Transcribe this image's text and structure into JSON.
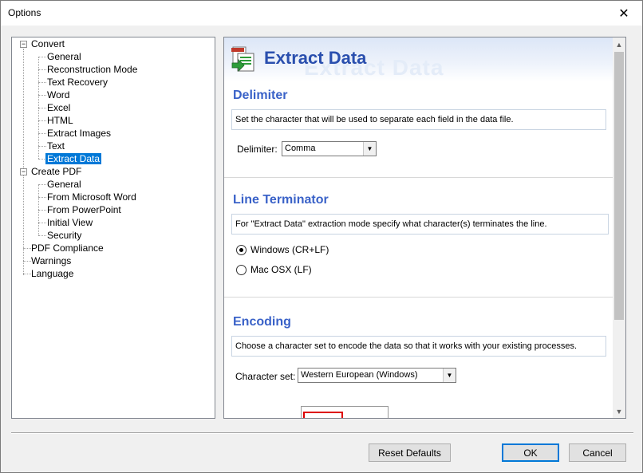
{
  "window": {
    "title": "Options",
    "close_glyph": "✕"
  },
  "tree": {
    "items": [
      {
        "label": "Convert",
        "expander": "−"
      },
      {
        "label": "General"
      },
      {
        "label": "Reconstruction Mode"
      },
      {
        "label": "Text Recovery"
      },
      {
        "label": "Word"
      },
      {
        "label": "Excel"
      },
      {
        "label": "HTML"
      },
      {
        "label": "Extract Images"
      },
      {
        "label": "Text"
      },
      {
        "label": "Extract Data",
        "selected": true
      },
      {
        "label": "Create PDF",
        "expander": "−"
      },
      {
        "label": "General"
      },
      {
        "label": "From Microsoft Word"
      },
      {
        "label": "From PowerPoint"
      },
      {
        "label": "Initial View"
      },
      {
        "label": "Security"
      },
      {
        "label": "PDF Compliance"
      },
      {
        "label": "Warnings"
      },
      {
        "label": "Language"
      }
    ]
  },
  "panel": {
    "header_title": "Extract Data",
    "header_icon": "extract-data-icon",
    "delimiter": {
      "title": "Delimiter",
      "description": "Set the character that will be used to separate each field in the data file.",
      "field_label": "Delimiter:",
      "value": "Comma"
    },
    "line_terminator": {
      "title": "Line Terminator",
      "description": "For \"Extract Data\" extraction mode specify what character(s) terminates the line.",
      "options": [
        {
          "label": "Windows (CR+LF)",
          "checked": true
        },
        {
          "label": "Mac OSX (LF)",
          "checked": false
        }
      ]
    },
    "encoding": {
      "title": "Encoding",
      "description": "Choose a character set to encode the data so that it works with your existing processes.",
      "field_label": "Character set:",
      "value": "Western European (Windows)"
    }
  },
  "buttons": {
    "reset": "Reset Defaults",
    "ok": "OK",
    "cancel": "Cancel"
  },
  "colors": {
    "accent": "#0078d7",
    "section_title": "#3a62c8",
    "header_title": "#2a4fae"
  }
}
